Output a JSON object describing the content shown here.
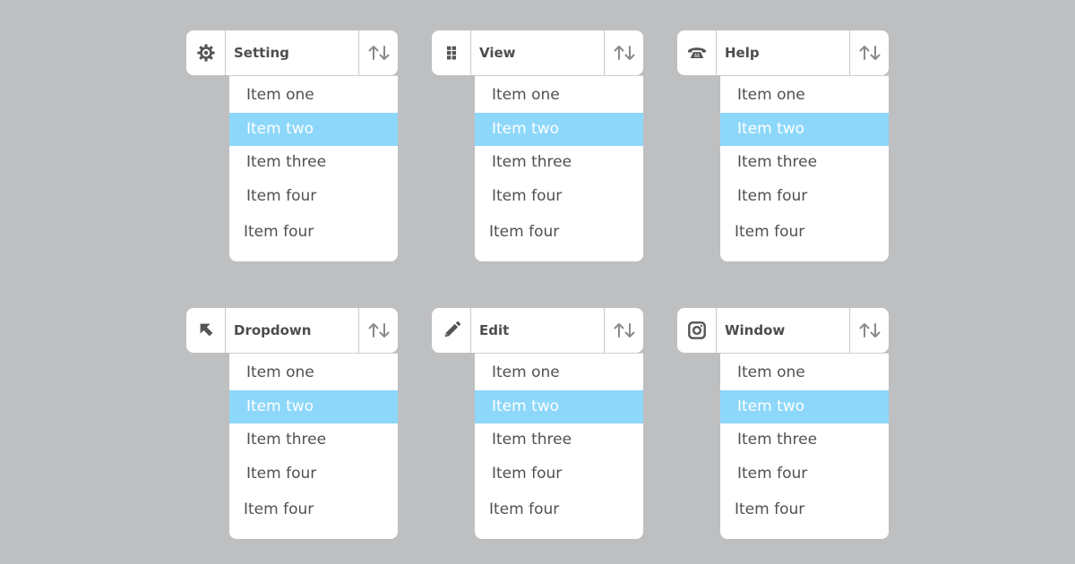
{
  "dropdowns": [
    {
      "title": "Setting",
      "icon": "gear-icon",
      "items": [
        "Item one",
        "Item two",
        "Item three",
        "Item four",
        "Item four"
      ],
      "selected_index": 1
    },
    {
      "title": "View",
      "icon": "grid-icon",
      "items": [
        "Item one",
        "Item two",
        "Item three",
        "Item four",
        "Item four"
      ],
      "selected_index": 1
    },
    {
      "title": "Help",
      "icon": "telephone-icon",
      "items": [
        "Item one",
        "Item two",
        "Item three",
        "Item four",
        "Item four"
      ],
      "selected_index": 1
    },
    {
      "title": "Dropdown",
      "icon": "cursor-arrow-icon",
      "items": [
        "Item one",
        "Item two",
        "Item three",
        "Item four",
        "Item four"
      ],
      "selected_index": 1
    },
    {
      "title": "Edit",
      "icon": "pencil-icon",
      "items": [
        "Item one",
        "Item two",
        "Item three",
        "Item four",
        "Item four"
      ],
      "selected_index": 1
    },
    {
      "title": "Window",
      "icon": "camera-icon",
      "items": [
        "Item one",
        "Item two",
        "Item three",
        "Item four",
        "Item four"
      ],
      "selected_index": 1
    }
  ],
  "sort_icon": "sort-arrows-icon",
  "colors": {
    "background": "#bebfc1",
    "panel": "#ffffff",
    "selected": "#8cd7fa",
    "text": "#505050",
    "icon": "#555555",
    "sort_icon": "#8a8a8a"
  }
}
